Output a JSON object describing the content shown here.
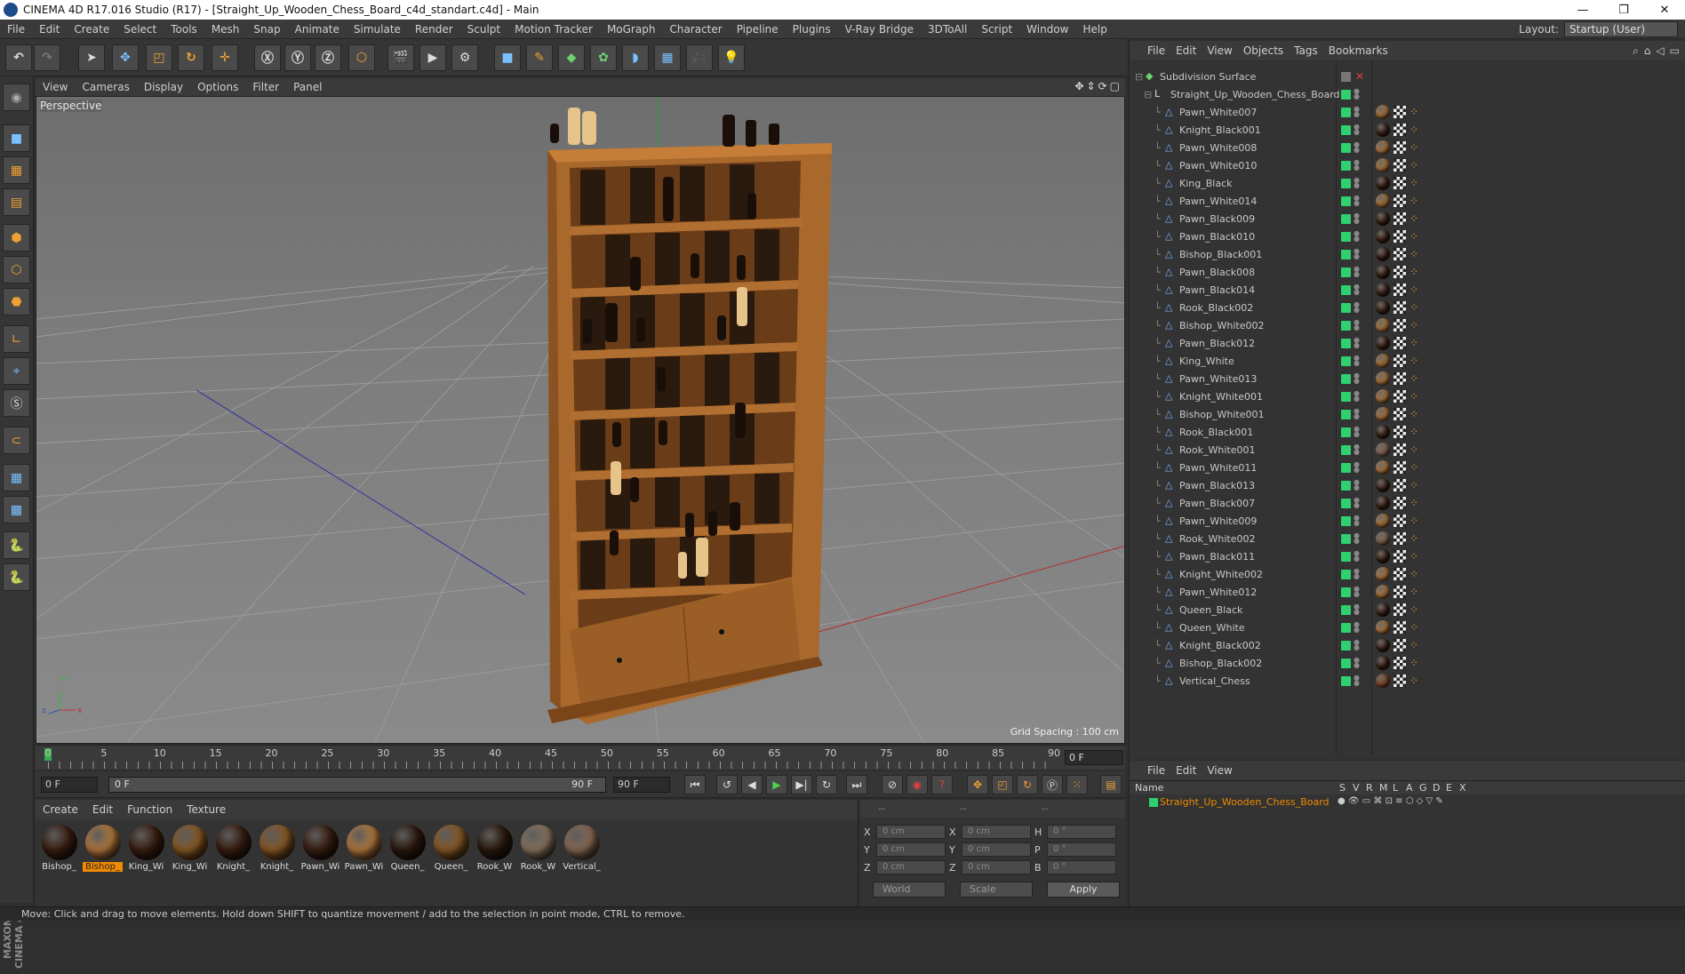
{
  "window": {
    "title": "CINEMA 4D R17.016 Studio (R17) - [Straight_Up_Wooden_Chess_Board_c4d_standart.c4d] - Main",
    "min": "—",
    "max": "❐",
    "close": "✕"
  },
  "menu": [
    "File",
    "Edit",
    "Create",
    "Select",
    "Tools",
    "Mesh",
    "Snap",
    "Animate",
    "Simulate",
    "Render",
    "Sculpt",
    "Motion Tracker",
    "MoGraph",
    "Character",
    "Pipeline",
    "Plugins",
    "V-Ray Bridge",
    "3DToAll",
    "Script",
    "Window",
    "Help"
  ],
  "layout": {
    "label": "Layout:",
    "value": "Startup (User)"
  },
  "viewport": {
    "menu": [
      "View",
      "Cameras",
      "Display",
      "Options",
      "Filter",
      "Panel"
    ],
    "label": "Perspective",
    "grid_spacing": "Grid Spacing : 100 cm",
    "axis": {
      "x": "x",
      "y": "Y",
      "z": "z"
    }
  },
  "timeline": {
    "ticks": [
      "0",
      "5",
      "10",
      "15",
      "20",
      "25",
      "30",
      "35",
      "40",
      "45",
      "50",
      "55",
      "60",
      "65",
      "70",
      "75",
      "80",
      "85",
      "90"
    ],
    "current_frame": "0 F"
  },
  "transport": {
    "start": "0 F",
    "slider_start": "0 F",
    "slider_end": "90 F",
    "end": "90 F"
  },
  "materials": {
    "menu": [
      "Create",
      "Edit",
      "Function",
      "Texture"
    ],
    "items": [
      {
        "name": "Bishop_",
        "color": "#3a1f12",
        "selected": false
      },
      {
        "name": "Bishop_",
        "color": "#b57a3e",
        "selected": true
      },
      {
        "name": "King_Wi",
        "color": "#3a1f12",
        "selected": false
      },
      {
        "name": "King_Wi",
        "color": "#8a5a25",
        "selected": false
      },
      {
        "name": "Knight_",
        "color": "#3a1f12",
        "selected": false
      },
      {
        "name": "Knight_",
        "color": "#8a5a25",
        "selected": false
      },
      {
        "name": "Pawn_Wi",
        "color": "#3a1f12",
        "selected": false
      },
      {
        "name": "Pawn_Wi",
        "color": "#b57a3e",
        "selected": false
      },
      {
        "name": "Queen_",
        "color": "#2d1a0f",
        "selected": false
      },
      {
        "name": "Queen_",
        "color": "#8a5a25",
        "selected": false
      },
      {
        "name": "Rook_W",
        "color": "#2d1a0f",
        "selected": false
      },
      {
        "name": "Rook_W",
        "color": "#8a7560",
        "selected": false
      },
      {
        "name": "Vertical_",
        "color": "#8a6a55",
        "selected": false
      }
    ]
  },
  "attributes": {
    "header": [
      "--",
      "--",
      "--"
    ],
    "rows": [
      {
        "l1": "X",
        "v1": "0 cm",
        "l2": "X",
        "v2": "0 cm",
        "l3": "H",
        "v3": "0 °"
      },
      {
        "l1": "Y",
        "v1": "0 cm",
        "l2": "Y",
        "v2": "0 cm",
        "l3": "P",
        "v3": "0 °"
      },
      {
        "l1": "Z",
        "v1": "0 cm",
        "l2": "Z",
        "v2": "0 cm",
        "l3": "B",
        "v3": "0 °"
      }
    ],
    "world": "World",
    "scale": "Scale",
    "apply": "Apply"
  },
  "status": "Move: Click and drag to move elements. Hold down SHIFT to quantize movement / add to the selection in point mode, CTRL to remove.",
  "objects": {
    "menu": [
      "File",
      "Edit",
      "View",
      "Objects",
      "Tags",
      "Bookmarks"
    ],
    "root": "Subdivision Surface",
    "group": "Straight_Up_Wooden_Chess_Board",
    "items": [
      {
        "name": "Pawn_White007",
        "mat": "#b57a3e"
      },
      {
        "name": "Knight_Black001",
        "mat": "#3a1f12"
      },
      {
        "name": "Pawn_White008",
        "mat": "#b57a3e"
      },
      {
        "name": "Pawn_White010",
        "mat": "#b57a3e"
      },
      {
        "name": "King_Black",
        "mat": "#3a1f12"
      },
      {
        "name": "Pawn_White014",
        "mat": "#b57a3e"
      },
      {
        "name": "Pawn_Black009",
        "mat": "#3a1f12"
      },
      {
        "name": "Pawn_Black010",
        "mat": "#3a1f12"
      },
      {
        "name": "Bishop_Black001",
        "mat": "#3a1f12"
      },
      {
        "name": "Pawn_Black008",
        "mat": "#3a1f12"
      },
      {
        "name": "Pawn_Black014",
        "mat": "#3a1f12"
      },
      {
        "name": "Rook_Black002",
        "mat": "#3a1f12"
      },
      {
        "name": "Bishop_White002",
        "mat": "#b57a3e"
      },
      {
        "name": "Pawn_Black012",
        "mat": "#3a1f12"
      },
      {
        "name": "King_White",
        "mat": "#b57a3e"
      },
      {
        "name": "Pawn_White013",
        "mat": "#b57a3e"
      },
      {
        "name": "Knight_White001",
        "mat": "#b57a3e"
      },
      {
        "name": "Bishop_White001",
        "mat": "#b57a3e"
      },
      {
        "name": "Rook_Black001",
        "mat": "#3a1f12"
      },
      {
        "name": "Rook_White001",
        "mat": "#8a6a55"
      },
      {
        "name": "Pawn_White011",
        "mat": "#b57a3e"
      },
      {
        "name": "Pawn_Black013",
        "mat": "#3a1f12"
      },
      {
        "name": "Pawn_Black007",
        "mat": "#3a1f12"
      },
      {
        "name": "Pawn_White009",
        "mat": "#b57a3e"
      },
      {
        "name": "Rook_White002",
        "mat": "#8a6a55"
      },
      {
        "name": "Pawn_Black011",
        "mat": "#3a1f12"
      },
      {
        "name": "Knight_White002",
        "mat": "#b57a3e"
      },
      {
        "name": "Pawn_White012",
        "mat": "#b57a3e"
      },
      {
        "name": "Queen_Black",
        "mat": "#3a1f12"
      },
      {
        "name": "Queen_White",
        "mat": "#b57a3e"
      },
      {
        "name": "Knight_Black002",
        "mat": "#3a1f12"
      },
      {
        "name": "Bishop_Black002",
        "mat": "#3a1f12"
      },
      {
        "name": "Vertical_Chess",
        "mat": "#8a4a2a"
      }
    ]
  },
  "layers": {
    "menu": [
      "File",
      "Edit",
      "View"
    ],
    "name_header": "Name",
    "cols": [
      "S",
      "V",
      "R",
      "M",
      "L",
      "A",
      "G",
      "D",
      "E",
      "X"
    ],
    "row": "Straight_Up_Wooden_Chess_Board"
  },
  "colors": {
    "accent": "#f08a00",
    "visible_dot": "#2ed070",
    "bg": "#333333"
  },
  "toolbar_icons": [
    "undo-icon",
    "redo-icon",
    "select-arrow-icon",
    "move-icon",
    "scale-icon",
    "rotate-icon",
    "axis-icon",
    "x-axis-lock-icon",
    "y-axis-lock-icon",
    "z-axis-lock-icon",
    "coordinate-system-icon",
    "render-view-icon",
    "render-picture-viewer-icon",
    "edit-render-settings-icon",
    "cube-icon",
    "pen-spline-icon",
    "subdivision-icon",
    "array-icon",
    "deformer-icon",
    "floor-icon",
    "camera-icon",
    "light-icon"
  ]
}
